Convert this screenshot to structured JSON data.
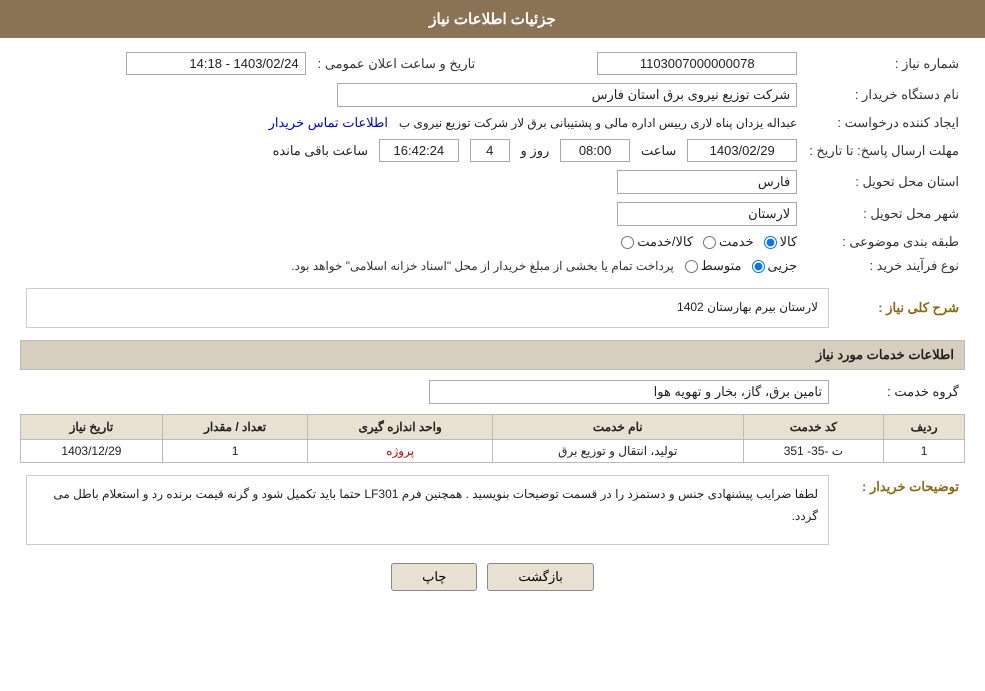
{
  "header": {
    "title": "جزئیات اطلاعات نیاز"
  },
  "fields": {
    "shomara_niaz_label": "شماره نیاز :",
    "shomara_niaz_value": "1103007000000078",
    "nam_dastgah_label": "نام دستگاه خریدار :",
    "nam_dastgah_value": "شرکت توزیع نیروی برق استان فارس",
    "ijad_label": "ایجاد کننده درخواست :",
    "ijad_value": "عبداله یزدان پناه لاری رییس اداره مالی و پشتیبانی برق لار شرکت توزیع نیروی ب",
    "contact_link": "اطلاعات تماس خریدار",
    "mohlat_label": "مهلت ارسال پاسخ: تا تاریخ :",
    "mohlat_date": "1403/02/29",
    "mohlat_saat_label": "ساعت",
    "mohlat_saat": "08:00",
    "mohlat_rooz_label": "روز و",
    "mohlat_rooz": "4",
    "mohlat_mande_label": "ساعت باقی مانده",
    "mohlat_mande": "16:42:24",
    "tarikh_elan_label": "تاریخ و ساعت اعلان عمومی :",
    "tarikh_elan_value": "1403/02/24 - 14:18",
    "ostan_label": "استان محل تحویل :",
    "ostan_value": "فارس",
    "shahr_label": "شهر محل تحویل :",
    "shahr_value": "لارستان",
    "tabaqe_label": "طبقه بندی موضوعی :",
    "tabaqe_kala": "کالا",
    "tabaqe_khedmat": "خدمت",
    "tabaqe_kala_khedmat": "کالا/خدمت",
    "navae_label": "نوع فرآیند خرید :",
    "navae_jozi": "جزیی",
    "navae_motavasset": "متوسط",
    "navae_desc": "پرداخت تمام یا بخشی از مبلغ خریدار از محل \"اسناد خزانه اسلامی\" خواهد بود.",
    "sharh_label": "شرح کلی نیاز :",
    "sharh_value": "لارستان بیرم بهارستان 1402",
    "khadamat_header": "اطلاعات خدمات مورد نیاز",
    "goroh_label": "گروه خدمت :",
    "goroh_value": "تامین برق، گاز، بخار و تهویه هوا",
    "table": {
      "headers": [
        "ردیف",
        "کد خدمت",
        "نام خدمت",
        "واحد اندازه گیری",
        "تعداد / مقدار",
        "تاریخ نیاز"
      ],
      "rows": [
        {
          "radif": "1",
          "code": "ت -35- 351",
          "name": "تولید، انتقال و توزیع برق",
          "unit": "پروژه",
          "count": "1",
          "date": "1403/12/29"
        }
      ]
    },
    "tawzihat_label": "توضیحات خریدار :",
    "tawzihat_value": "لطفا ضرایب پیشنهادی جنس و دستمزد را در قسمت توضیحات بنویسید . همچنین فرم LF301 حتما باید تکمیل شود و گرنه قیمت برنده رد و استعلام باطل می گردد."
  },
  "buttons": {
    "print": "چاپ",
    "back": "بازگشت"
  }
}
